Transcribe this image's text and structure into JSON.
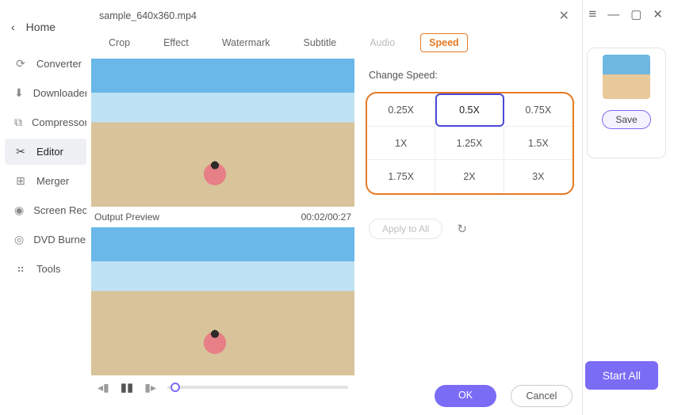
{
  "app": {
    "home_label": "Home",
    "outer_controls": {
      "min": "—",
      "max": "▢",
      "close": "✕"
    }
  },
  "sidebar": {
    "items": [
      {
        "icon": "⟳",
        "label": "Converter"
      },
      {
        "icon": "⬇",
        "label": "Downloader"
      },
      {
        "icon": "⧉",
        "label": "Compressor"
      },
      {
        "icon": "✂",
        "label": "Editor",
        "active": true
      },
      {
        "icon": "⊞",
        "label": "Merger"
      },
      {
        "icon": "◉",
        "label": "Screen Recorder"
      },
      {
        "icon": "◎",
        "label": "DVD Burner"
      },
      {
        "icon": "⠶",
        "label": "Tools"
      }
    ]
  },
  "bg": {
    "save": "Save",
    "start": "Start All"
  },
  "dialog": {
    "title": "sample_640x360.mp4",
    "tabs": [
      {
        "label": "Crop"
      },
      {
        "label": "Effect"
      },
      {
        "label": "Watermark"
      },
      {
        "label": "Subtitle"
      },
      {
        "label": "Audio",
        "disabled": true
      },
      {
        "label": "Speed",
        "active": true
      }
    ],
    "output_preview_label": "Output Preview",
    "time": "00:02/00:27",
    "section": "Change Speed:",
    "speeds": [
      "0.25X",
      "0.5X",
      "0.75X",
      "1X",
      "1.25X",
      "1.5X",
      "1.75X",
      "2X",
      "3X"
    ],
    "selected_speed": "0.5X",
    "apply_all": "Apply to All",
    "ok": "OK",
    "cancel": "Cancel"
  }
}
